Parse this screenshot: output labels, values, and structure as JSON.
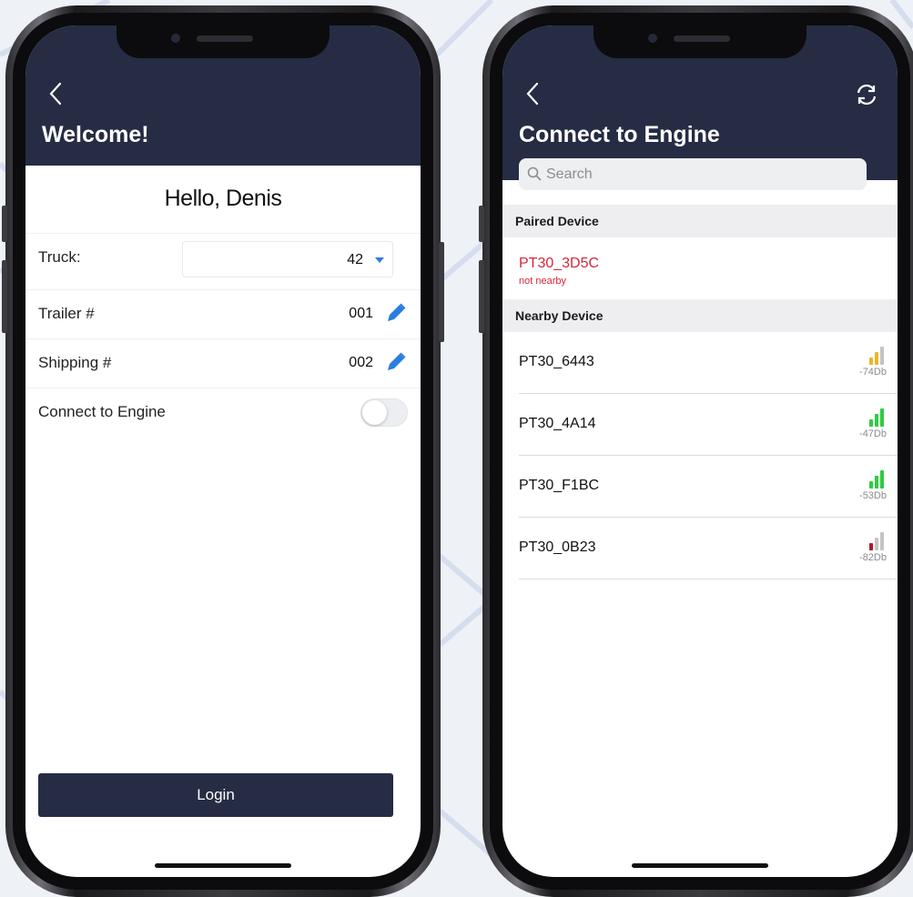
{
  "left_screen": {
    "title": "Welcome!",
    "greeting": "Hello, Denis",
    "truck": {
      "label": "Truck:",
      "value": "42"
    },
    "trailer": {
      "label": "Trailer #",
      "value": "001"
    },
    "shipping": {
      "label": "Shipping #",
      "value": "002"
    },
    "connect": {
      "label": "Connect to Engine",
      "enabled": false
    },
    "login_label": "Login"
  },
  "right_screen": {
    "title": "Connect to Engine",
    "search": {
      "placeholder": "Search"
    },
    "paired_header": "Paired Device",
    "paired_device": {
      "name": "PT30_3D5C",
      "status": "not nearby"
    },
    "nearby_header": "Nearby Device",
    "nearby_devices": [
      {
        "name": "PT30_6443",
        "signal": "-74Db",
        "bars": 2,
        "color": "#f0b429"
      },
      {
        "name": "PT30_4A14",
        "signal": "-47Db",
        "bars": 3,
        "color": "#2ecc40"
      },
      {
        "name": "PT30_F1BC",
        "signal": "-53Db",
        "bars": 3,
        "color": "#2ecc40"
      },
      {
        "name": "PT30_0B23",
        "signal": "-82Db",
        "bars": 1,
        "color": "#b3142a"
      }
    ]
  },
  "colors": {
    "nav_bg": "#252c44",
    "accent_blue": "#2a7de1",
    "alert_red": "#d6263a"
  }
}
